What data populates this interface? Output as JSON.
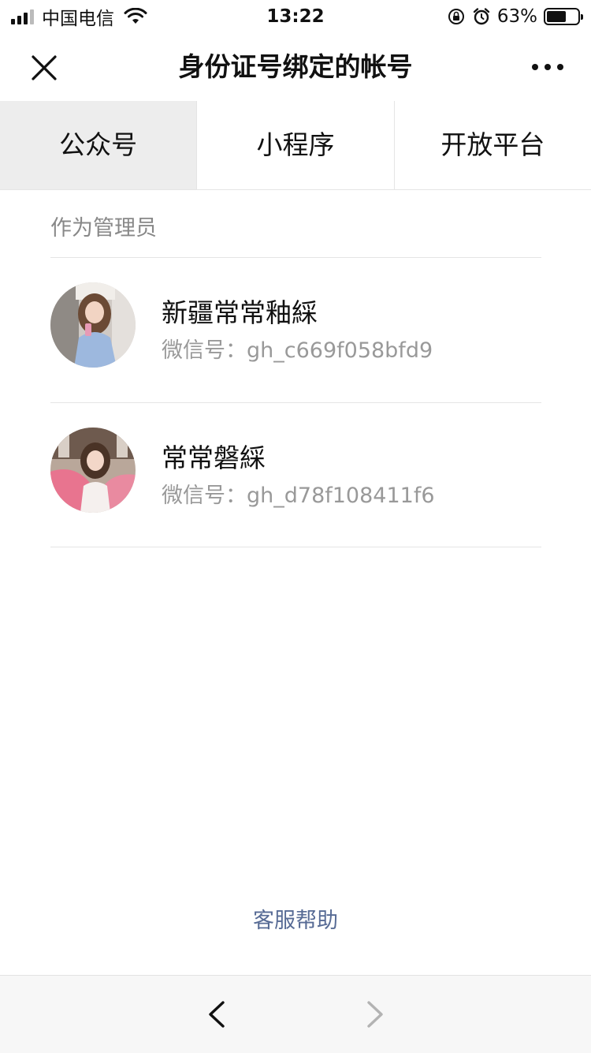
{
  "status_bar": {
    "carrier": "中国电信",
    "time": "13:22",
    "battery_percent": "63%",
    "battery_level": 0.63,
    "icons": [
      "signal-icon",
      "wifi-icon",
      "orientation-lock-icon",
      "alarm-icon",
      "battery-icon"
    ]
  },
  "nav": {
    "title": "身份证号绑定的帐号",
    "close_icon": "close-icon",
    "more_icon": "more-icon"
  },
  "tabs": [
    {
      "label": "公众号",
      "active": true
    },
    {
      "label": "小程序",
      "active": false
    },
    {
      "label": "开放平台",
      "active": false
    }
  ],
  "section": {
    "label": "作为管理员"
  },
  "accounts": [
    {
      "name": "新疆常常釉綵",
      "id_label": "微信号：gh_c669f058bfd9"
    },
    {
      "name": "常常磐綵",
      "id_label": "微信号：gh_d78f108411f6"
    }
  ],
  "footer": {
    "help_link": "客服帮助"
  },
  "toolbar": {
    "back_icon": "chevron-left-icon",
    "forward_icon": "chevron-right-icon"
  },
  "colors": {
    "link": "#576b95",
    "active_tab_bg": "#ededed",
    "secondary_text": "#999999",
    "toolbar_bg": "#f7f7f7"
  }
}
